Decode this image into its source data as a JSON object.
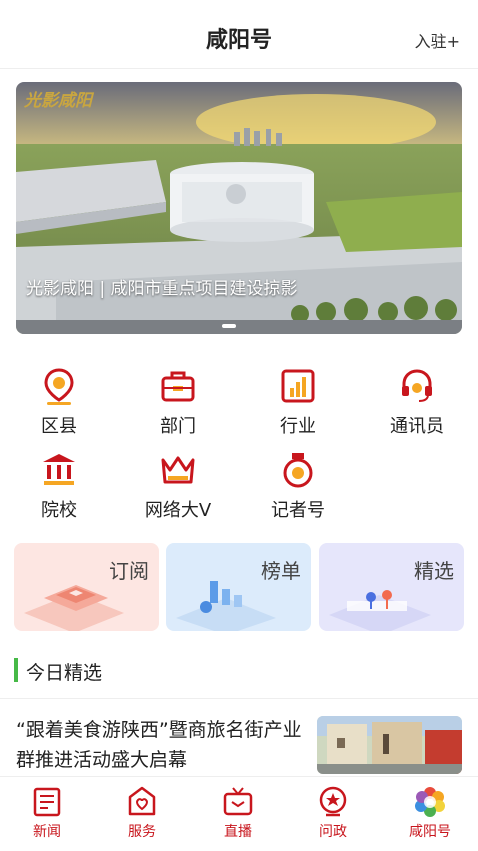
{
  "header": {
    "title": "咸阳号",
    "join_label": "入驻+"
  },
  "banner": {
    "logo_text": "光影咸阳",
    "caption": "光影咸阳 | 咸阳市重点项目建设掠影"
  },
  "categories": [
    {
      "label": "区县",
      "icon": "location-pin-icon"
    },
    {
      "label": "部门",
      "icon": "briefcase-icon"
    },
    {
      "label": "行业",
      "icon": "bar-chart-icon"
    },
    {
      "label": "通讯员",
      "icon": "headset-icon"
    },
    {
      "label": "院校",
      "icon": "building-columns-icon"
    },
    {
      "label": "网络大V",
      "icon": "crown-icon"
    },
    {
      "label": "记者号",
      "icon": "medal-icon"
    }
  ],
  "cards": [
    {
      "label": "订阅",
      "icon": "subscribe-cube-icon"
    },
    {
      "label": "榜单",
      "icon": "ranking-bars-icon"
    },
    {
      "label": "精选",
      "icon": "featured-pins-icon"
    }
  ],
  "section": {
    "title": "今日精选"
  },
  "news": [
    {
      "title": "“跟着美食游陕西”暨商旅名街产业群推进活动盛大启幕"
    }
  ],
  "tabs": [
    {
      "label": "新闻",
      "icon": "newspaper-icon"
    },
    {
      "label": "服务",
      "icon": "heart-shield-icon"
    },
    {
      "label": "直播",
      "icon": "tv-icon"
    },
    {
      "label": "问政",
      "icon": "star-badge-icon"
    },
    {
      "label": "咸阳号",
      "icon": "colorful-flower-icon"
    }
  ],
  "colors": {
    "brand_red": "#c8161d",
    "accent_green": "#46b947"
  }
}
